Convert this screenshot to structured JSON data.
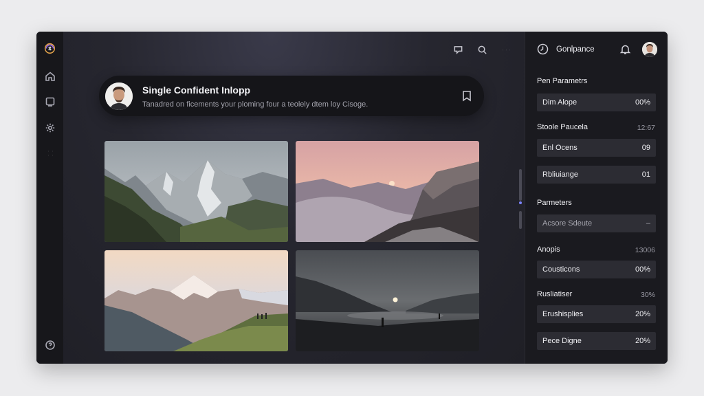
{
  "rail": {
    "items": [
      {
        "icon": "logo-icon"
      },
      {
        "icon": "home-icon"
      },
      {
        "icon": "message-icon"
      },
      {
        "icon": "gear-icon"
      },
      {
        "icon": "grid-icon"
      },
      {
        "icon": "help-icon"
      }
    ]
  },
  "toolbar": {
    "icons": [
      "chat-icon",
      "search-icon",
      "more-icon"
    ]
  },
  "card": {
    "title": "Single Confident Inlopp",
    "subtitle": "Tanadred on ficements your ploming four a teolely dtem loy Cisoge.",
    "icon": "bookmark-icon"
  },
  "gallery": {
    "photos": [
      "mountain-valley",
      "sunset-fog-valley",
      "alpine-peak-sunrise",
      "dusk-lake-silhouette"
    ]
  },
  "panel": {
    "header": {
      "title": "Gonlpance",
      "icons": [
        "clock-icon",
        "bell-icon",
        "avatar"
      ]
    },
    "section1": {
      "title": "Pen Parametrs"
    },
    "row1": {
      "label": "Dim Alope",
      "value": "00%"
    },
    "section2": {
      "title": "Stoole Paucela",
      "value": "12:67"
    },
    "row2": {
      "label": "Enl Ocens",
      "value": "09"
    },
    "row3": {
      "label": "Rbliuiange",
      "value": "01"
    },
    "section3": {
      "title": "Parmeters"
    },
    "row4": {
      "label": "Acsore Sdeute",
      "value": "–"
    },
    "section4": {
      "title": "Anopis",
      "value": "13006"
    },
    "row5": {
      "label": "Cousticons",
      "value": "00%"
    },
    "section5": {
      "title": "Rusliatiser",
      "value": "30%"
    },
    "row6": {
      "label": "Erushisplies",
      "value": "20%"
    },
    "row7": {
      "label": "Pece Digne",
      "value": "20%"
    }
  },
  "colors": {
    "accent": "#7d84ff",
    "background": "#1c1c22",
    "panel": "#1a1a1f",
    "row": "#2c2c33"
  }
}
